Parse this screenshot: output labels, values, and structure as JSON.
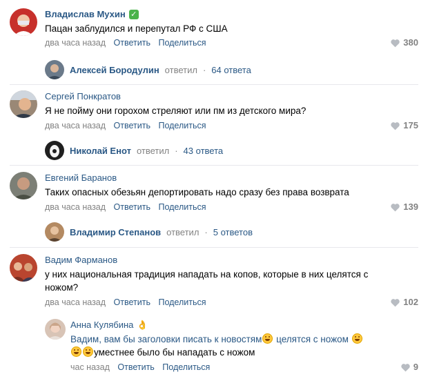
{
  "comments": [
    {
      "author": "Владислав Мухин",
      "verified": true,
      "text": "Пацан заблудился и перепутал РФ с США",
      "time": "два часа назад",
      "reply_label": "Ответить",
      "share_label": "Поделиться",
      "likes": "380",
      "thread": {
        "name": "Алексей Бородулин",
        "action": "ответил",
        "dot": "·",
        "count": "64 ответа"
      }
    },
    {
      "author": "Сергей Понкратов",
      "text": "Я не пойму они горохом стреляют или пм из детского мира?",
      "time": "два часа назад",
      "reply_label": "Ответить",
      "share_label": "Поделиться",
      "likes": "175",
      "thread": {
        "name": "Николай Енот",
        "action": "ответил",
        "dot": "·",
        "count": "43 ответа"
      }
    },
    {
      "author": "Евгений Баранов",
      "text": "Таких опасных обезьян депортировать надо сразу без права возврата",
      "time": "два часа назад",
      "reply_label": "Ответить",
      "share_label": "Поделиться",
      "likes": "139",
      "thread": {
        "name": "Владимир Степанов",
        "action": "ответил",
        "dot": "·",
        "count": "5 ответов"
      }
    },
    {
      "author": "Вадим Фарманов",
      "text_line1": "у них национальная традиция нападать на копов, которые в них целятся с",
      "text_line2": "ножом?",
      "time": "два часа назад",
      "reply_label": "Ответить",
      "share_label": "Поделиться",
      "likes": "102"
    }
  ],
  "reply": {
    "author": "Анна Кулябина",
    "author_icon": "waving-hand-icon",
    "text_part1": "Вадим, вам бы заголовки писать к новостям",
    "text_part2": " целятся с ножом ",
    "text_part3": "уместнее было бы нападать с ножом",
    "emoji": "grinning-face-emoji",
    "time": "час назад",
    "reply_label": "Ответить",
    "share_label": "Поделиться",
    "likes": "9"
  },
  "colors": {
    "link": "#2a5885",
    "muted": "#828282",
    "separator": "#e7e8ec",
    "verified": "#4bb34b"
  }
}
